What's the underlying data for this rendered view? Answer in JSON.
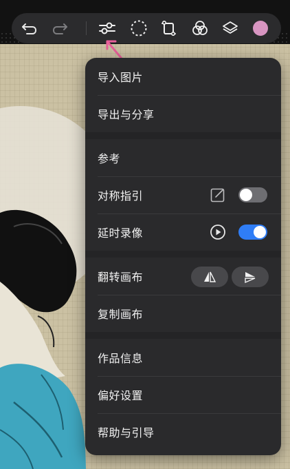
{
  "menu": {
    "import_image": "导入图片",
    "export_share": "导出与分享",
    "reference": "参考",
    "symmetry_guide": "对称指引",
    "timelapse_record": "延时录像",
    "flip_canvas": "翻转画布",
    "duplicate_canvas": "复制画布",
    "artwork_info": "作品信息",
    "preferences": "偏好设置",
    "help_guide": "帮助与引导"
  },
  "toggles": {
    "symmetry_guide_on": false,
    "timelapse_record_on": true
  },
  "toolbar": {
    "icons": [
      "undo-icon",
      "redo-icon",
      "adjust-sliders-icon",
      "selection-lasso-icon",
      "transform-icon",
      "color-blend-icon",
      "layers-icon",
      "color-swatch"
    ],
    "current_color": "#d895c1"
  },
  "colors": {
    "accent": "#2f7df6",
    "annotation_arrow": "#e8609a"
  }
}
